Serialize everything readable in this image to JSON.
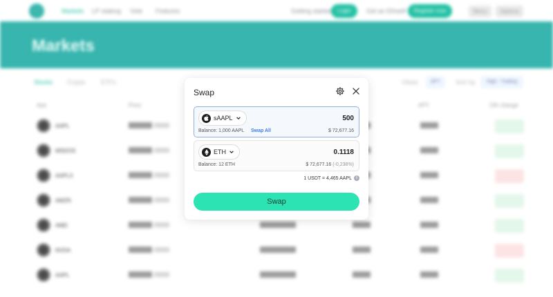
{
  "nav": {
    "links": [
      "Markets",
      "LP staking",
      "Vote",
      "Features"
    ],
    "cta": [
      "Getting started",
      "Login",
      "Get an Ethself",
      "Register now"
    ],
    "buttons": [
      "Menu",
      "Options"
    ]
  },
  "hero": {
    "title": "Markets"
  },
  "market": {
    "tabs": [
      "Stocks",
      "Crypto",
      "ETFs"
    ],
    "filters": {
      "sort_label": "Sort by",
      "sort_value": "High - Trading",
      "view_label": "Views",
      "view_value": "APY"
    },
    "headers": [
      "Ape",
      "Price",
      "24h vol",
      "APY",
      "24h change"
    ],
    "rows": [
      {
        "ticker": "AAPL",
        "negative": false
      },
      {
        "ticker": "MSDOS",
        "negative": false
      },
      {
        "ticker": "AAPLX",
        "negative": true
      },
      {
        "ticker": "AMZN",
        "negative": false
      },
      {
        "ticker": "AMD",
        "negative": false
      },
      {
        "ticker": "NVDA",
        "negative": true
      },
      {
        "ticker": "AAPL",
        "negative": false
      }
    ]
  },
  "swap": {
    "title": "Swap",
    "settings_icon": "gear-icon",
    "close_icon": "close-icon",
    "from": {
      "token": "sAAPL",
      "amount": "500",
      "balance": "Balance: 1,000 AAPL",
      "swap_all": "Swap All",
      "usd": "$ 72,677.16"
    },
    "to": {
      "token": "ETH",
      "amount": "0.1118",
      "balance": "Balance: 12 ETH",
      "usd": "$ 72,677.16",
      "change": "(-0,238%)"
    },
    "rate": "1 USDT = 4,465 AAPL",
    "button": "Swap"
  },
  "colors": {
    "accent": "#23c1a4",
    "hero": "#37b5ae",
    "swap_button": "#2be3b3",
    "link": "#3f7be6"
  }
}
